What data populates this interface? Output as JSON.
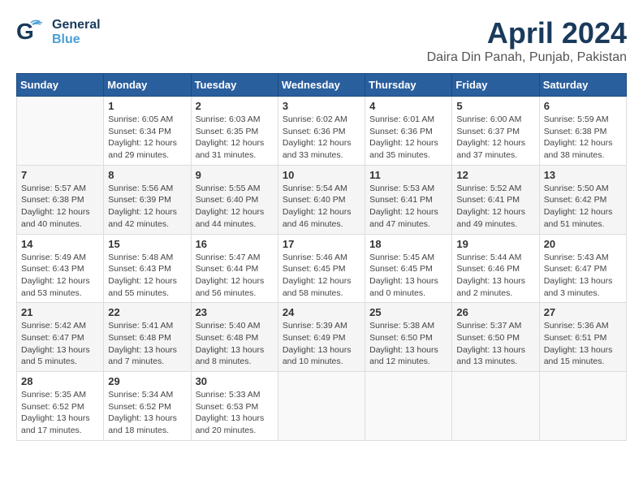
{
  "logo": {
    "general": "General",
    "blue": "Blue"
  },
  "title": "April 2024",
  "subtitle": "Daira Din Panah, Punjab, Pakistan",
  "days_header": [
    "Sunday",
    "Monday",
    "Tuesday",
    "Wednesday",
    "Thursday",
    "Friday",
    "Saturday"
  ],
  "weeks": [
    [
      {
        "num": "",
        "info": ""
      },
      {
        "num": "1",
        "info": "Sunrise: 6:05 AM\nSunset: 6:34 PM\nDaylight: 12 hours\nand 29 minutes."
      },
      {
        "num": "2",
        "info": "Sunrise: 6:03 AM\nSunset: 6:35 PM\nDaylight: 12 hours\nand 31 minutes."
      },
      {
        "num": "3",
        "info": "Sunrise: 6:02 AM\nSunset: 6:36 PM\nDaylight: 12 hours\nand 33 minutes."
      },
      {
        "num": "4",
        "info": "Sunrise: 6:01 AM\nSunset: 6:36 PM\nDaylight: 12 hours\nand 35 minutes."
      },
      {
        "num": "5",
        "info": "Sunrise: 6:00 AM\nSunset: 6:37 PM\nDaylight: 12 hours\nand 37 minutes."
      },
      {
        "num": "6",
        "info": "Sunrise: 5:59 AM\nSunset: 6:38 PM\nDaylight: 12 hours\nand 38 minutes."
      }
    ],
    [
      {
        "num": "7",
        "info": "Sunrise: 5:57 AM\nSunset: 6:38 PM\nDaylight: 12 hours\nand 40 minutes."
      },
      {
        "num": "8",
        "info": "Sunrise: 5:56 AM\nSunset: 6:39 PM\nDaylight: 12 hours\nand 42 minutes."
      },
      {
        "num": "9",
        "info": "Sunrise: 5:55 AM\nSunset: 6:40 PM\nDaylight: 12 hours\nand 44 minutes."
      },
      {
        "num": "10",
        "info": "Sunrise: 5:54 AM\nSunset: 6:40 PM\nDaylight: 12 hours\nand 46 minutes."
      },
      {
        "num": "11",
        "info": "Sunrise: 5:53 AM\nSunset: 6:41 PM\nDaylight: 12 hours\nand 47 minutes."
      },
      {
        "num": "12",
        "info": "Sunrise: 5:52 AM\nSunset: 6:41 PM\nDaylight: 12 hours\nand 49 minutes."
      },
      {
        "num": "13",
        "info": "Sunrise: 5:50 AM\nSunset: 6:42 PM\nDaylight: 12 hours\nand 51 minutes."
      }
    ],
    [
      {
        "num": "14",
        "info": "Sunrise: 5:49 AM\nSunset: 6:43 PM\nDaylight: 12 hours\nand 53 minutes."
      },
      {
        "num": "15",
        "info": "Sunrise: 5:48 AM\nSunset: 6:43 PM\nDaylight: 12 hours\nand 55 minutes."
      },
      {
        "num": "16",
        "info": "Sunrise: 5:47 AM\nSunset: 6:44 PM\nDaylight: 12 hours\nand 56 minutes."
      },
      {
        "num": "17",
        "info": "Sunrise: 5:46 AM\nSunset: 6:45 PM\nDaylight: 12 hours\nand 58 minutes."
      },
      {
        "num": "18",
        "info": "Sunrise: 5:45 AM\nSunset: 6:45 PM\nDaylight: 13 hours\nand 0 minutes."
      },
      {
        "num": "19",
        "info": "Sunrise: 5:44 AM\nSunset: 6:46 PM\nDaylight: 13 hours\nand 2 minutes."
      },
      {
        "num": "20",
        "info": "Sunrise: 5:43 AM\nSunset: 6:47 PM\nDaylight: 13 hours\nand 3 minutes."
      }
    ],
    [
      {
        "num": "21",
        "info": "Sunrise: 5:42 AM\nSunset: 6:47 PM\nDaylight: 13 hours\nand 5 minutes."
      },
      {
        "num": "22",
        "info": "Sunrise: 5:41 AM\nSunset: 6:48 PM\nDaylight: 13 hours\nand 7 minutes."
      },
      {
        "num": "23",
        "info": "Sunrise: 5:40 AM\nSunset: 6:48 PM\nDaylight: 13 hours\nand 8 minutes."
      },
      {
        "num": "24",
        "info": "Sunrise: 5:39 AM\nSunset: 6:49 PM\nDaylight: 13 hours\nand 10 minutes."
      },
      {
        "num": "25",
        "info": "Sunrise: 5:38 AM\nSunset: 6:50 PM\nDaylight: 13 hours\nand 12 minutes."
      },
      {
        "num": "26",
        "info": "Sunrise: 5:37 AM\nSunset: 6:50 PM\nDaylight: 13 hours\nand 13 minutes."
      },
      {
        "num": "27",
        "info": "Sunrise: 5:36 AM\nSunset: 6:51 PM\nDaylight: 13 hours\nand 15 minutes."
      }
    ],
    [
      {
        "num": "28",
        "info": "Sunrise: 5:35 AM\nSunset: 6:52 PM\nDaylight: 13 hours\nand 17 minutes."
      },
      {
        "num": "29",
        "info": "Sunrise: 5:34 AM\nSunset: 6:52 PM\nDaylight: 13 hours\nand 18 minutes."
      },
      {
        "num": "30",
        "info": "Sunrise: 5:33 AM\nSunset: 6:53 PM\nDaylight: 13 hours\nand 20 minutes."
      },
      {
        "num": "",
        "info": ""
      },
      {
        "num": "",
        "info": ""
      },
      {
        "num": "",
        "info": ""
      },
      {
        "num": "",
        "info": ""
      }
    ]
  ]
}
